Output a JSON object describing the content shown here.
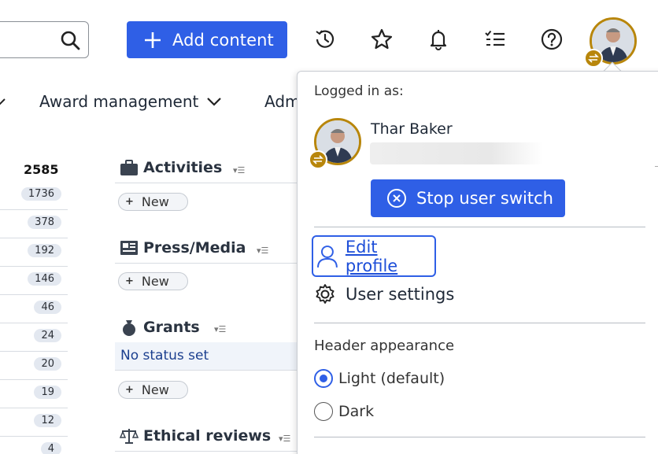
{
  "topbar": {
    "search_icon": "search-icon",
    "add_content_label": "Add content",
    "icons": [
      "history-icon",
      "star-icon",
      "bell-icon",
      "tasks-icon",
      "help-icon"
    ],
    "accent_color": "#2f5fe6",
    "switch_badge_color": "#b8860b"
  },
  "nav": {
    "award_management": "Award management",
    "admin_partial": "Adm"
  },
  "counts": {
    "header": "2585",
    "rows": [
      "1736",
      "378",
      "192",
      "146",
      "46",
      "24",
      "20",
      "19",
      "12",
      "4"
    ]
  },
  "sections": {
    "activities": {
      "title": "Activities",
      "new_label": "New"
    },
    "press_media": {
      "title": "Press/Media",
      "new_label": "New"
    },
    "grants": {
      "title": "Grants",
      "status": "No status set",
      "new_label": "New"
    },
    "ethical_reviews": {
      "title": "Ethical reviews"
    }
  },
  "user_menu": {
    "logged_in_as": "Logged in as:",
    "user_name": "Thar Baker",
    "stop_switch_label": "Stop user switch",
    "edit_profile_label": "Edit profile",
    "user_settings_label": "User settings",
    "header_appearance_label": "Header appearance",
    "options": [
      {
        "label": "Light (default)",
        "selected": true
      },
      {
        "label": "Dark",
        "selected": false
      }
    ]
  }
}
